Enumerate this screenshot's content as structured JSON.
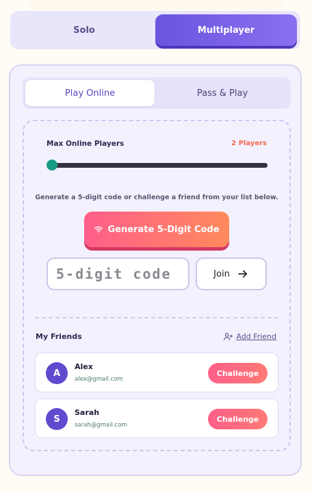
{
  "mode_toggle": {
    "solo_label": "Solo",
    "multiplayer_label": "Multiplayer",
    "selected": "Multiplayer"
  },
  "play_toggle": {
    "online_label": "Play Online",
    "pass_label": "Pass & Play",
    "selected": "Play Online"
  },
  "players": {
    "label": "Max Online Players",
    "count_text": "2 Players",
    "slider_fraction": 0
  },
  "code_section": {
    "info": "Generate a 5-digit code or challenge a friend from your list below.",
    "generate_label": "Generate 5-Digit Code",
    "input_placeholder": "5-digit code",
    "input_value": "",
    "join_label": "Join"
  },
  "friends": {
    "title": "My Friends",
    "add_label": "Add Friend",
    "items": [
      {
        "initial": "A",
        "name": "Alex",
        "email": "alex@gmail.com",
        "action": "Challenge"
      },
      {
        "initial": "S",
        "name": "Sarah",
        "email": "sarah@gmail.com",
        "action": "Challenge"
      }
    ]
  },
  "colors": {
    "accent": "#6a54de",
    "cta_start": "#ff5e8a",
    "cta_end": "#ff8a5c",
    "slider_thumb": "#179c87",
    "players_count": "#f46a4e"
  },
  "icons": {
    "generate": "wifi-icon",
    "join": "arrow-right-icon",
    "add_friend": "user-plus-icon"
  }
}
